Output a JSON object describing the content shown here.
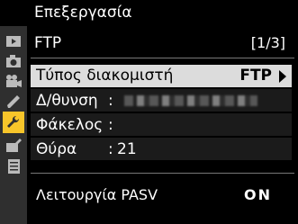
{
  "header": {
    "title": "Επεξεργασία"
  },
  "subheader": {
    "title": "FTP",
    "page": "[1/3]"
  },
  "sidebar": {
    "items": [
      {
        "icon": "playback-icon"
      },
      {
        "icon": "camera-icon"
      },
      {
        "icon": "movie-camera-icon"
      },
      {
        "icon": "pencil-icon"
      },
      {
        "icon": "wrench-icon",
        "active": true
      },
      {
        "icon": "retouch-icon"
      },
      {
        "icon": "recent-settings-icon"
      }
    ]
  },
  "rows": {
    "server_type": {
      "label": "Τύπος διακομιστή",
      "value": "FTP"
    },
    "address": {
      "label": "Δ/θυνση",
      "colon": ":"
    },
    "folder": {
      "label": "Φάκελος",
      "colon": ":"
    },
    "port": {
      "label": "Θύρα",
      "colon": ":",
      "value": "21"
    },
    "pasv": {
      "label": "Λειτουργία PASV",
      "value": "ON"
    }
  },
  "colors": {
    "accent": "#f7c52a",
    "highlight": "#dcdcdc",
    "sidebar": "#2f2f2f"
  }
}
